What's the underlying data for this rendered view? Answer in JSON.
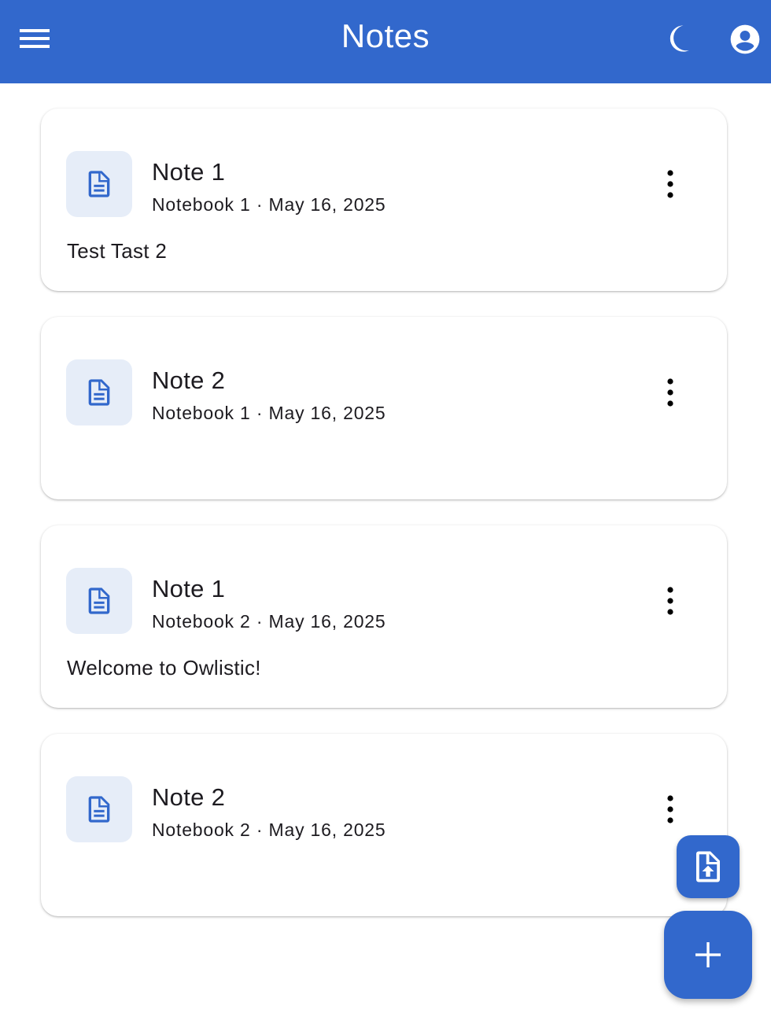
{
  "app_bar": {
    "title": "Notes",
    "menu_icon": "hamburger-menu-icon",
    "theme_icon": "dark-mode-moon-icon",
    "account_icon": "account-circle-icon"
  },
  "notes": [
    {
      "title": "Note 1",
      "notebook": "Notebook 1",
      "separator": "·",
      "date": "May 16, 2025",
      "preview": "Test Tast 2",
      "icon": "document-icon"
    },
    {
      "title": "Note 2",
      "notebook": "Notebook 1",
      "separator": "·",
      "date": "May 16, 2025",
      "preview": "",
      "icon": "document-icon"
    },
    {
      "title": "Note 1",
      "notebook": "Notebook 2",
      "separator": "·",
      "date": "May 16, 2025",
      "preview": "Welcome to Owlistic!",
      "icon": "document-icon"
    },
    {
      "title": "Note 2",
      "notebook": "Notebook 2",
      "separator": "·",
      "date": "May 16, 2025",
      "preview": "",
      "icon": "document-icon"
    }
  ],
  "fabs": {
    "import_icon": "file-upload-icon",
    "add_icon": "plus-icon"
  },
  "colors": {
    "primary": "#3268cc",
    "tile_background": "#e6edf8",
    "text": "#1d1b20",
    "on_primary": "#ffffff"
  }
}
